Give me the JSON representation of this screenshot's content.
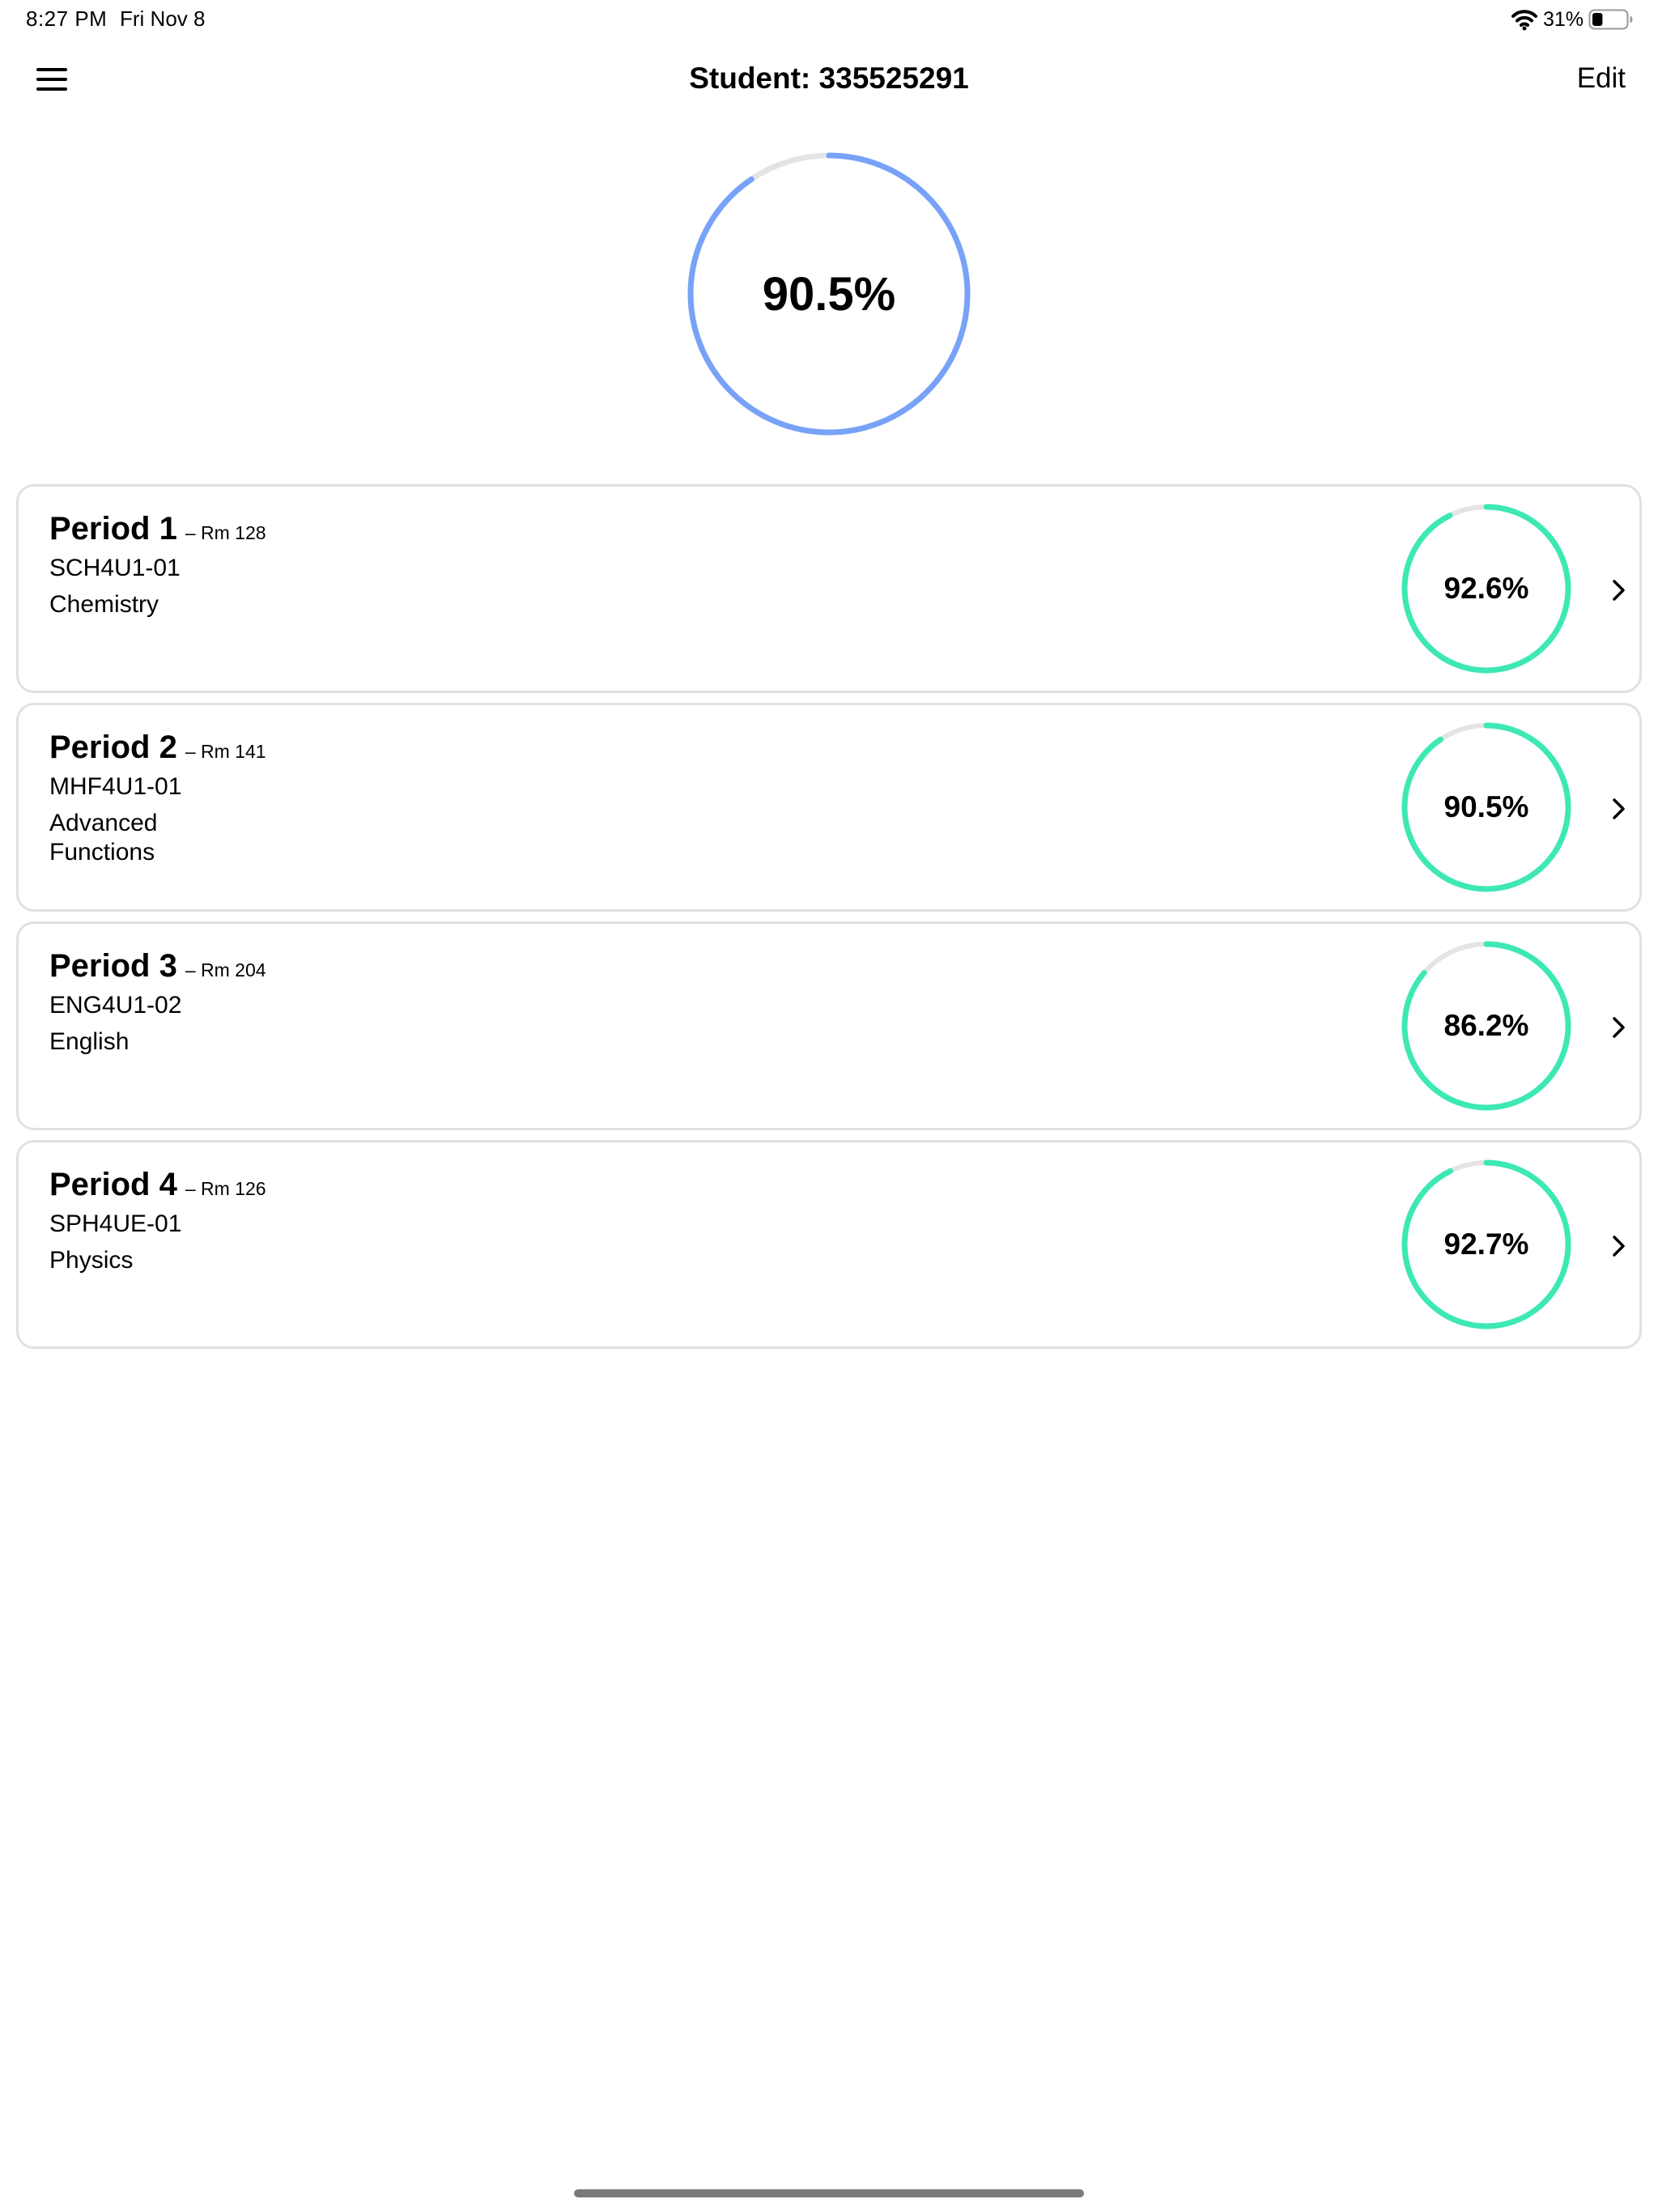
{
  "status_bar": {
    "time": "8:27 PM",
    "date": "Fri Nov 8",
    "battery_percent": "31%",
    "battery_level": 0.31
  },
  "nav": {
    "title": "Student: 335525291",
    "edit_label": "Edit",
    "menu_icon": "hamburger-menu-icon"
  },
  "overall": {
    "label": "90.5%",
    "value": 90.5,
    "color": "#78a2f8",
    "track_color": "#e4e4e6"
  },
  "courses": [
    {
      "period": "Period 1",
      "room": "– Rm 128",
      "code": "SCH4U1-01",
      "name": "Chemistry",
      "grade_label": "92.6%",
      "grade": 92.6
    },
    {
      "period": "Period 2",
      "room": "– Rm 141",
      "code": "MHF4U1-01",
      "name": "Advanced Functions",
      "grade_label": "90.5%",
      "grade": 90.5
    },
    {
      "period": "Period 3",
      "room": "– Rm 204",
      "code": "ENG4U1-02",
      "name": "English",
      "grade_label": "86.2%",
      "grade": 86.2
    },
    {
      "period": "Period 4",
      "room": "– Rm 126",
      "code": "SPH4UE-01",
      "name": "Physics",
      "grade_label": "92.7%",
      "grade": 92.7
    }
  ],
  "colors": {
    "course_ring": "#3de8b4",
    "track": "#e4e4e6",
    "card_border": "#e1e1e1"
  },
  "icons": {
    "chevron": "chevron-right-icon",
    "wifi": "wifi-icon",
    "battery": "battery-icon"
  }
}
